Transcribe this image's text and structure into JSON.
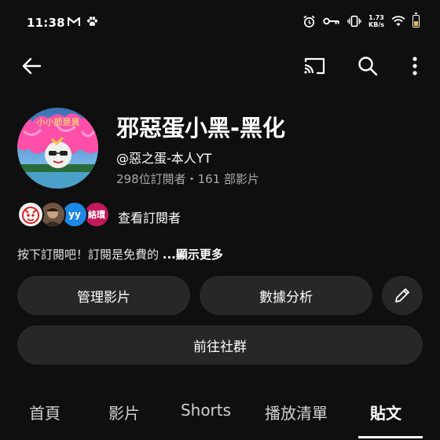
{
  "status": {
    "time": "11:38",
    "speed_value": "1.73",
    "speed_unit": "KB/s"
  },
  "icons": {
    "back": "back-arrow-icon",
    "cast": "cast-icon",
    "search": "search-icon",
    "more": "more-vert-icon",
    "edit": "pencil-icon"
  },
  "channel": {
    "avatar_text": "小小節是異",
    "name": "邪惡蛋小黑-黑化",
    "handle": "@惡之蛋-本人YT",
    "stats": "298位訂閱者・161 部影片"
  },
  "subscribers": {
    "avatar_labels": [
      "",
      "",
      "yy",
      "絡環"
    ],
    "view_label": "查看訂閱者"
  },
  "description": {
    "text": "按下訂閱吧！訂閱是免費的 ",
    "more": "...顯示更多"
  },
  "actions": {
    "manage": "管理影片",
    "analytics": "數據分析",
    "community": "前往社群"
  },
  "tabs": [
    {
      "label": "首頁",
      "active": false
    },
    {
      "label": "影片",
      "active": false
    },
    {
      "label": "Shorts",
      "active": false
    },
    {
      "label": "播放清單",
      "active": false
    },
    {
      "label": "貼文",
      "active": true
    }
  ],
  "colors": {
    "background": "#0f0f0f",
    "button": "#272727",
    "secondary_text": "#aaaaaa",
    "battery_level": "#e9c44a"
  }
}
